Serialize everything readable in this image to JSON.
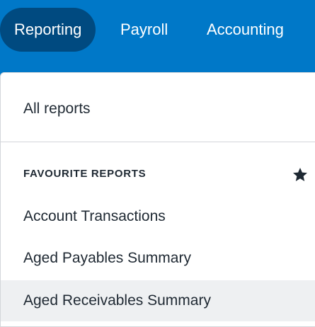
{
  "nav": {
    "tabs": [
      {
        "label": "Reporting",
        "active": true
      },
      {
        "label": "Payroll",
        "active": false
      },
      {
        "label": "Accounting",
        "active": false
      }
    ]
  },
  "menu": {
    "all_reports": "All reports",
    "favourites_header": "FAVOURITE REPORTS",
    "favourite_icon": "star-icon",
    "favourites": [
      {
        "label": "Account Transactions"
      },
      {
        "label": "Aged Payables Summary"
      },
      {
        "label": "Aged Receivables Summary",
        "hovered": true
      }
    ]
  },
  "colors": {
    "nav_background": "#0078c8",
    "active_tab": "#004a80",
    "hover_row": "#eef0f2",
    "text": "#1f2933"
  }
}
